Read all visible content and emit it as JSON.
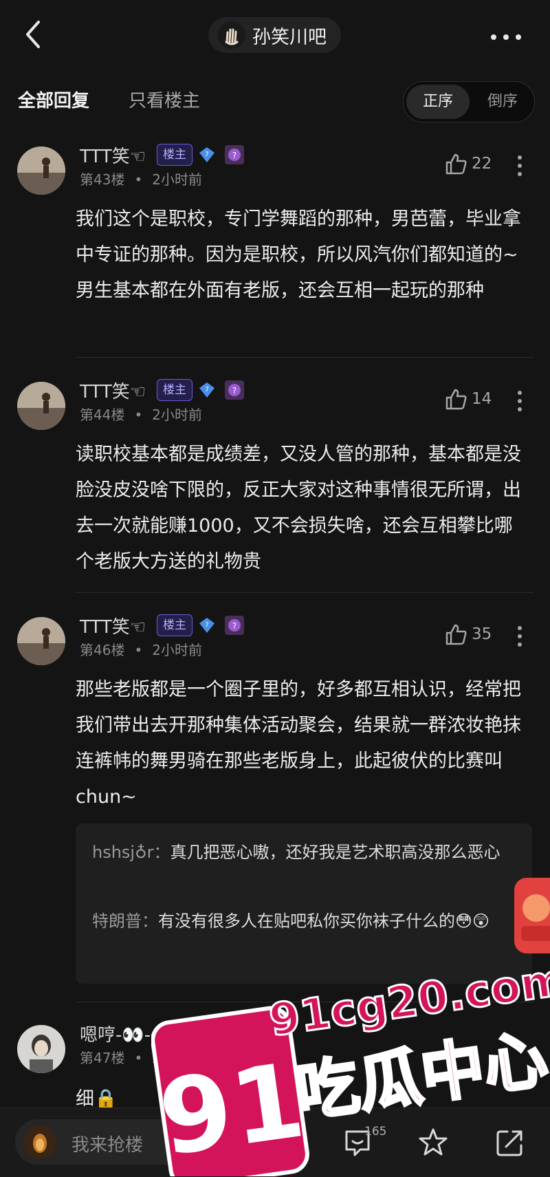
{
  "header": {
    "forum_name": "孙笑川吧",
    "back_icon": "chevron-left-icon",
    "more_icon": "more-horizontal-icon"
  },
  "tabs": {
    "all_replies": "全部回复",
    "op_only": "只看楼主",
    "order_asc": "正序",
    "order_desc": "倒序"
  },
  "posts": [
    {
      "username": "TTT笑☜",
      "badge": "楼主",
      "floor": "第43楼",
      "time": "2小时前",
      "likes": "22",
      "text": "我们这个是职校，专门学舞蹈的那种，男芭蕾，毕业拿中专证的那种。因为是职校，所以风汽你们都知道的~男生基本都在外面有老版，还会互相一起玩的那种"
    },
    {
      "username": "TTT笑☜",
      "badge": "楼主",
      "floor": "第44楼",
      "time": "2小时前",
      "likes": "14",
      "text": "读职校基本都是成绩差，又没人管的那种，基本都是没脸没皮没啥下限的，反正大家对这种事情很无所谓，出去一次就能赚1000，又不会损失啥，还会互相攀比哪个老版大方送的礼物贵"
    },
    {
      "username": "TTT笑☜",
      "badge": "楼主",
      "floor": "第46楼",
      "time": "2小时前",
      "likes": "35",
      "text": "那些老版都是一个圈子里的，好多都互相认识，经常把我们带出去开那种集体活动聚会，结果就一群浓妆艳抹连裤帏的舞男骑在那些老版身上，此起彼伏的比赛叫chun~",
      "replies": [
        {
          "who": "hshsj♁r：",
          "text": "真几把恶心嗷，还好我是艺术职高没那么恶心"
        },
        {
          "who": "特朗普：",
          "text": "有没有很多人在贴吧私你买你袜子什么的😳😲"
        }
      ]
    },
    {
      "username": "嗯哼-👀-",
      "floor": "第47楼",
      "time": "2小时前",
      "text": "细🔒"
    }
  ],
  "bottom": {
    "input_placeholder": "我来抢楼",
    "reply_count": "165"
  },
  "watermark": {
    "big_number": "91",
    "domain": "91cg20.com",
    "slogan": "吃瓜中心"
  },
  "colors": {
    "background": "#141414",
    "owner_badge": "#6e5bd8",
    "watermark_red": "#d4145a"
  }
}
